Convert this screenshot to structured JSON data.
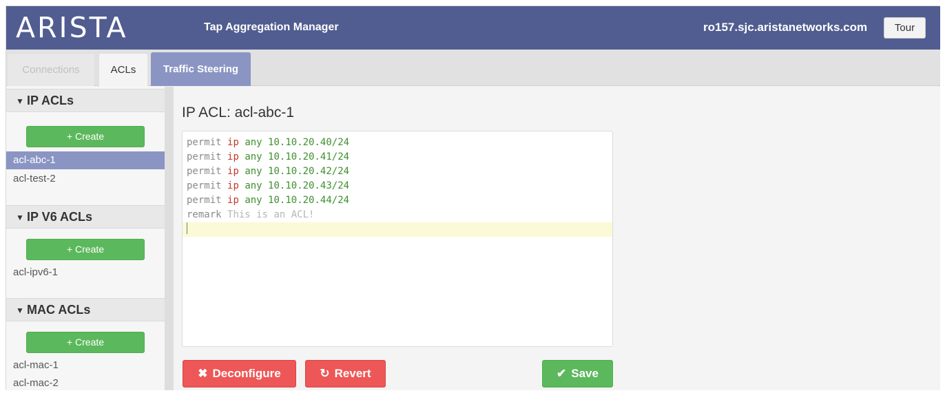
{
  "header": {
    "logo_text": "ARISTA",
    "app_title": "Tap Aggregation Manager",
    "hostname": "ro157.sjc.aristanetworks.com",
    "tour_label": "Tour",
    "bar_color": "#515d90"
  },
  "tabs": [
    {
      "label": "Connections",
      "state": "disabled"
    },
    {
      "label": "ACLs",
      "state": "active"
    },
    {
      "label": "Traffic Steering",
      "state": "highlighted"
    }
  ],
  "sidebar": {
    "sections": [
      {
        "title": "IP ACLs",
        "create_label": "+ Create",
        "items": [
          {
            "label": "acl-abc-1",
            "selected": true
          },
          {
            "label": "acl-test-2",
            "selected": false
          }
        ]
      },
      {
        "title": "IP V6 ACLs",
        "create_label": "+ Create",
        "items": [
          {
            "label": "acl-ipv6-1",
            "selected": false
          }
        ]
      },
      {
        "title": "MAC ACLs",
        "create_label": "+ Create",
        "items": [
          {
            "label": "acl-mac-1",
            "selected": false
          },
          {
            "label": "acl-mac-2",
            "selected": false
          }
        ]
      }
    ]
  },
  "main": {
    "title": "IP ACL: acl-abc-1",
    "editor_lines": [
      {
        "keyword": "permit",
        "protocol": "ip",
        "source": "any",
        "address": "10.10.20.40/24"
      },
      {
        "keyword": "permit",
        "protocol": "ip",
        "source": "any",
        "address": "10.10.20.41/24"
      },
      {
        "keyword": "permit",
        "protocol": "ip",
        "source": "any",
        "address": "10.10.20.42/24"
      },
      {
        "keyword": "permit",
        "protocol": "ip",
        "source": "any",
        "address": "10.10.20.43/24"
      },
      {
        "keyword": "permit",
        "protocol": "ip",
        "source": "any",
        "address": "10.10.20.44/24"
      }
    ],
    "remark_line": {
      "keyword": "remark",
      "text": "This is an ACL!"
    },
    "buttons": {
      "deconfigure_icon": "✖",
      "deconfigure_label": "Deconfigure",
      "revert_icon": "↻",
      "revert_label": "Revert",
      "save_icon": "✔",
      "save_label": "Save"
    }
  },
  "colors": {
    "accent": "#8b95c3",
    "success": "#5cb85c",
    "danger": "#ee5757"
  }
}
